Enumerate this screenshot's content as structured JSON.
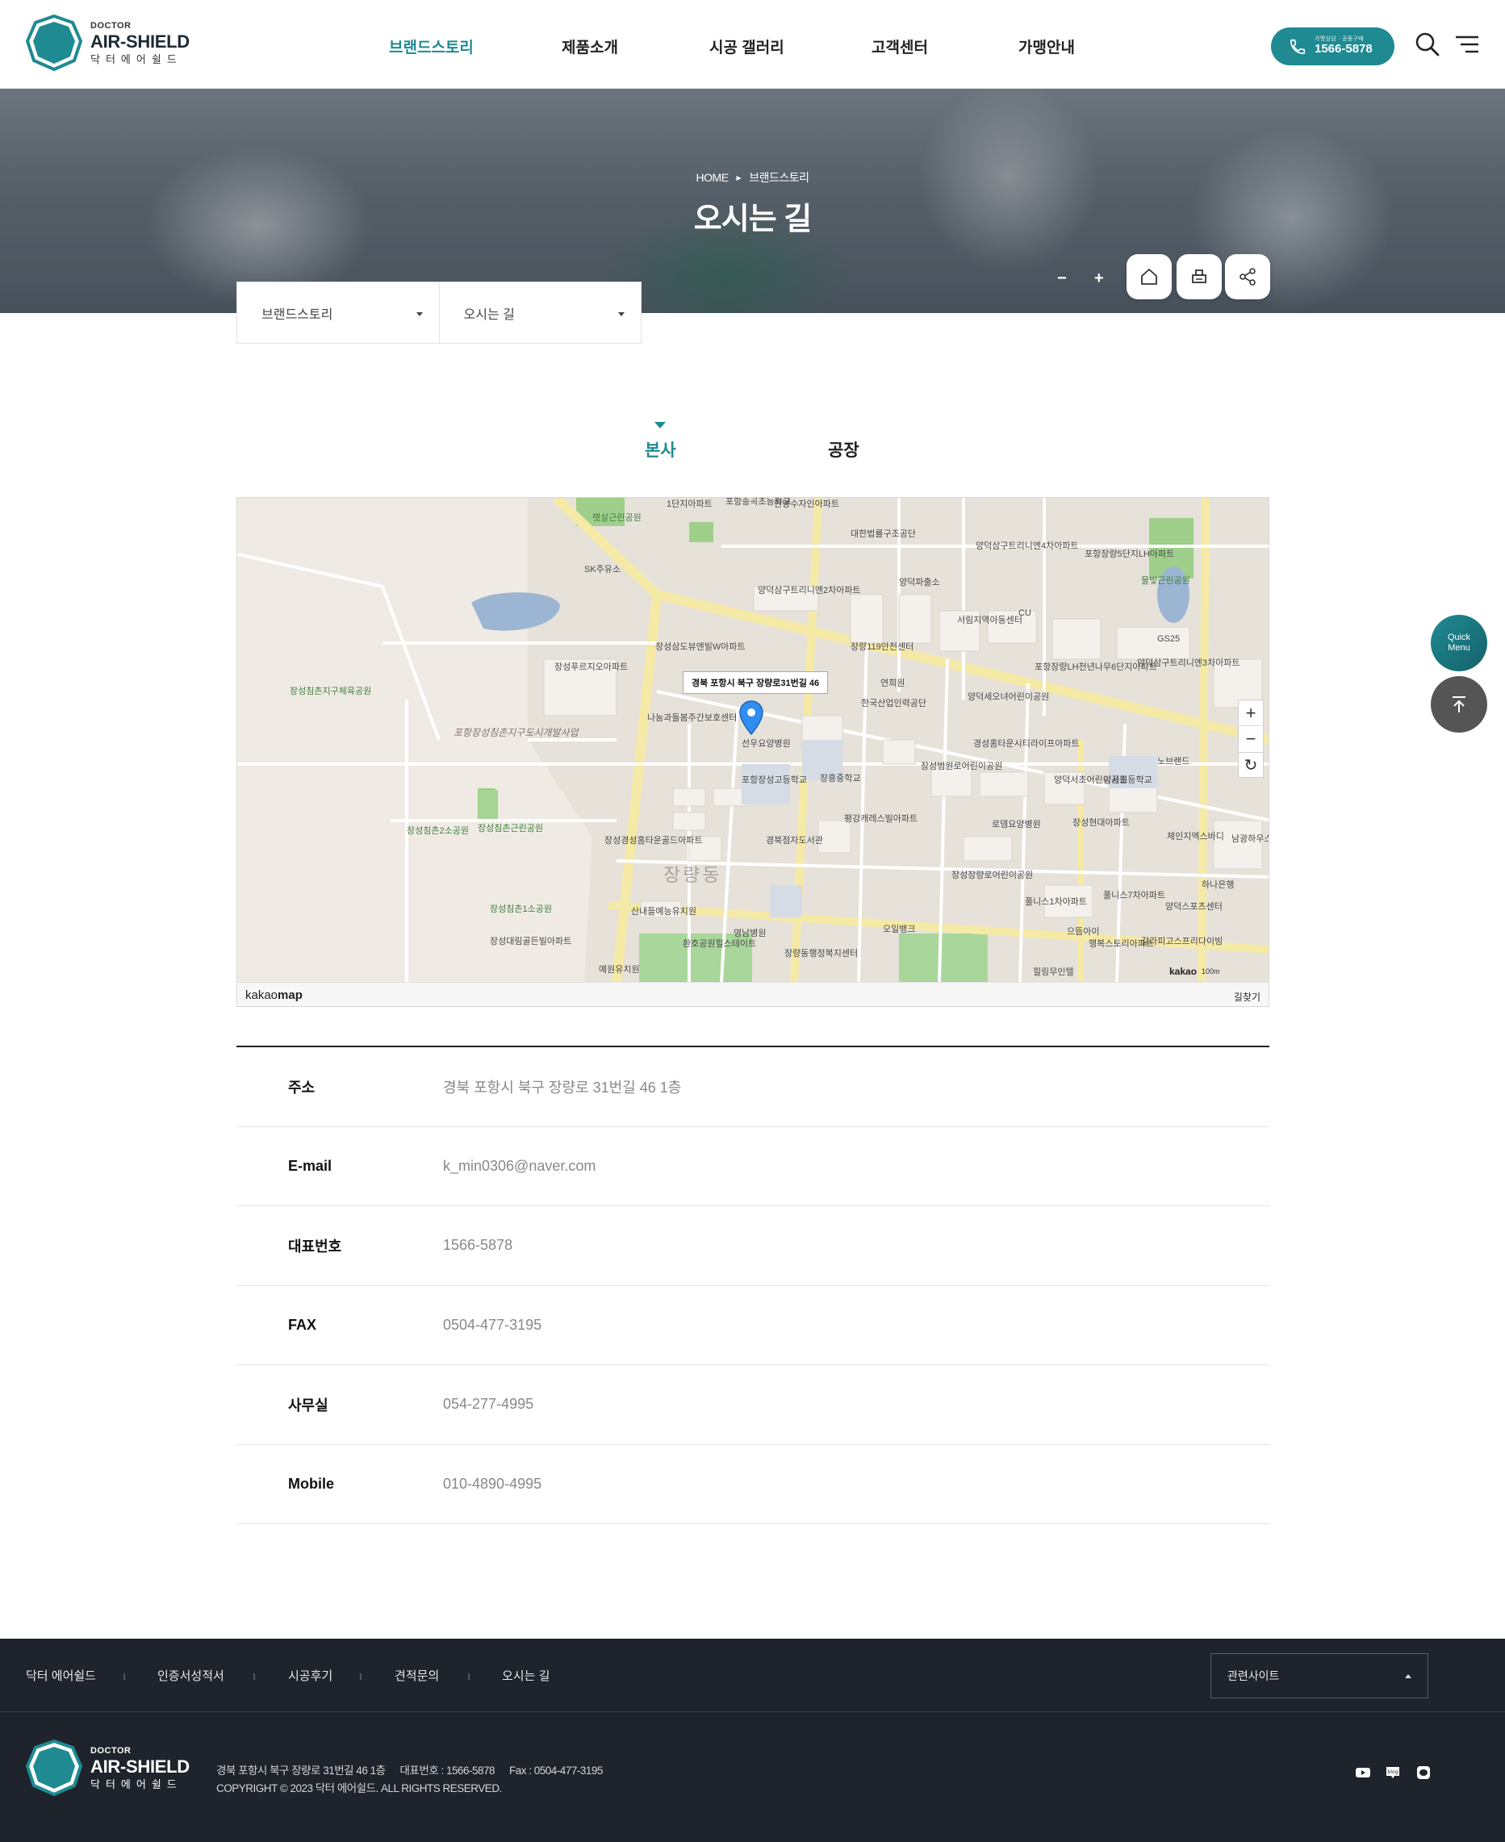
{
  "brand": {
    "small": "DOCTOR",
    "name": "AIR-SHIELD",
    "kr": "닥터에어쉴드",
    "badge_top": "AIR",
    "badge_mid": "SHIELD",
    "badge_sub": "Doctor Air Shield"
  },
  "nav": [
    {
      "label": "브랜드스토리",
      "active": true
    },
    {
      "label": "제품소개",
      "active": false
    },
    {
      "label": "시공 갤러리",
      "active": false
    },
    {
      "label": "고객센터",
      "active": false
    },
    {
      "label": "가맹안내",
      "active": false
    }
  ],
  "call": {
    "caption": "가맹상담 · 공동구매",
    "number": "1566-5878"
  },
  "hero": {
    "crumb_home": "HOME",
    "crumb_section": "브랜드스토리",
    "title": "오시는 길",
    "zoom_out": "−",
    "zoom_in": "+"
  },
  "subnav": {
    "depth1": "브랜드스토리",
    "depth2": "오시는 길"
  },
  "tabs": [
    {
      "label": "본사",
      "active": true
    },
    {
      "label": "공장",
      "active": false
    }
  ],
  "map": {
    "callout": "경북 포항시 북구 장량로31번길 46",
    "brand_left": "kakao",
    "brand_right": "map",
    "find_way": "길찾기",
    "kakao": "kakao",
    "scale": "100m",
    "labels": [
      "햇살근린공원",
      "포항송곡초등학교",
      "한양수자인아파트",
      "1단지아파트",
      "대한법률구조공단",
      "양덕삼구트리니엔4차아파트",
      "포항장량5단지LH아파트",
      "SK주유소",
      "양덕삼구트리니엔2차아파트",
      "양덕파출소",
      "CU",
      "서림지역아동센터",
      "물빛근린공원",
      "GS25",
      "장성삼도뷰엔빌W아파트",
      "장성푸르지오아파트",
      "장량119안전센터",
      "연희원",
      "포항장량LH천년나무6단지아파트",
      "양덕삼구트리니엔3차아파트",
      "장성침촌지구체육공원",
      "나눔과돌봄주간보호센터",
      "선우요양병원",
      "한국산업인력공단",
      "양덕세오녀어린이공원",
      "포항장성침촌지구도시개발사업",
      "포항장성고등학교",
      "장흥중학교",
      "장성범원로어린이공원",
      "경성홈타운시티라이프아파트",
      "양덕서초어린이공원",
      "양서초등학교",
      "노브랜드",
      "장성침촌2소공원",
      "장성침촌근린공원",
      "평강캐레스빌아파트",
      "로뎀요양병원",
      "장성현대아파트",
      "체인지엑스바디",
      "장성경성홈타운골드아파트",
      "경북점자도서관",
      "장량동",
      "장성침촌1소공원",
      "장성장량로어린이공원",
      "하나은행",
      "산내들예능유치원",
      "영남병원",
      "오일뱅크",
      "풀니스1차아파트",
      "풀니스7차아파트",
      "양덕스포츠센터",
      "장성대림골든빌아파트",
      "환호공원힐스테이트",
      "장량동행정복지센터",
      "으뜸아이",
      "행복스토리아파트",
      "갈라피고스프리다이빙",
      "예원유치원",
      "힐링무인텔",
      "남광하우스아파트"
    ]
  },
  "info": [
    {
      "key": "주소",
      "value": "경북 포항시 북구 장량로 31번길 46 1층"
    },
    {
      "key": "E-mail",
      "value": "k_min0306@naver.com"
    },
    {
      "key": "대표번호",
      "value": "1566-5878"
    },
    {
      "key": "FAX",
      "value": "0504-477-3195"
    },
    {
      "key": "사무실",
      "value": "054-277-4995"
    },
    {
      "key": "Mobile",
      "value": "010-4890-4995"
    }
  ],
  "quick": {
    "line1": "Quick",
    "line2": "Menu"
  },
  "footer": {
    "links": [
      "닥터 에어쉴드",
      "인증서성적서",
      "시공후기",
      "견적문의",
      "오시는 길"
    ],
    "family_site": "관련사이트",
    "address": "경북 포항시 북구 장량로 31번길 46 1층",
    "phone": "대표번호 : 1566-5878",
    "fax": "Fax : 0504-477-3195",
    "copyright": "COPYRIGHT © 2023 닥터 에어쉴드. ALL RIGHTS RESERVED."
  },
  "colors": {
    "accent": "#1f8a92",
    "footer_bg": "#1f232b"
  }
}
